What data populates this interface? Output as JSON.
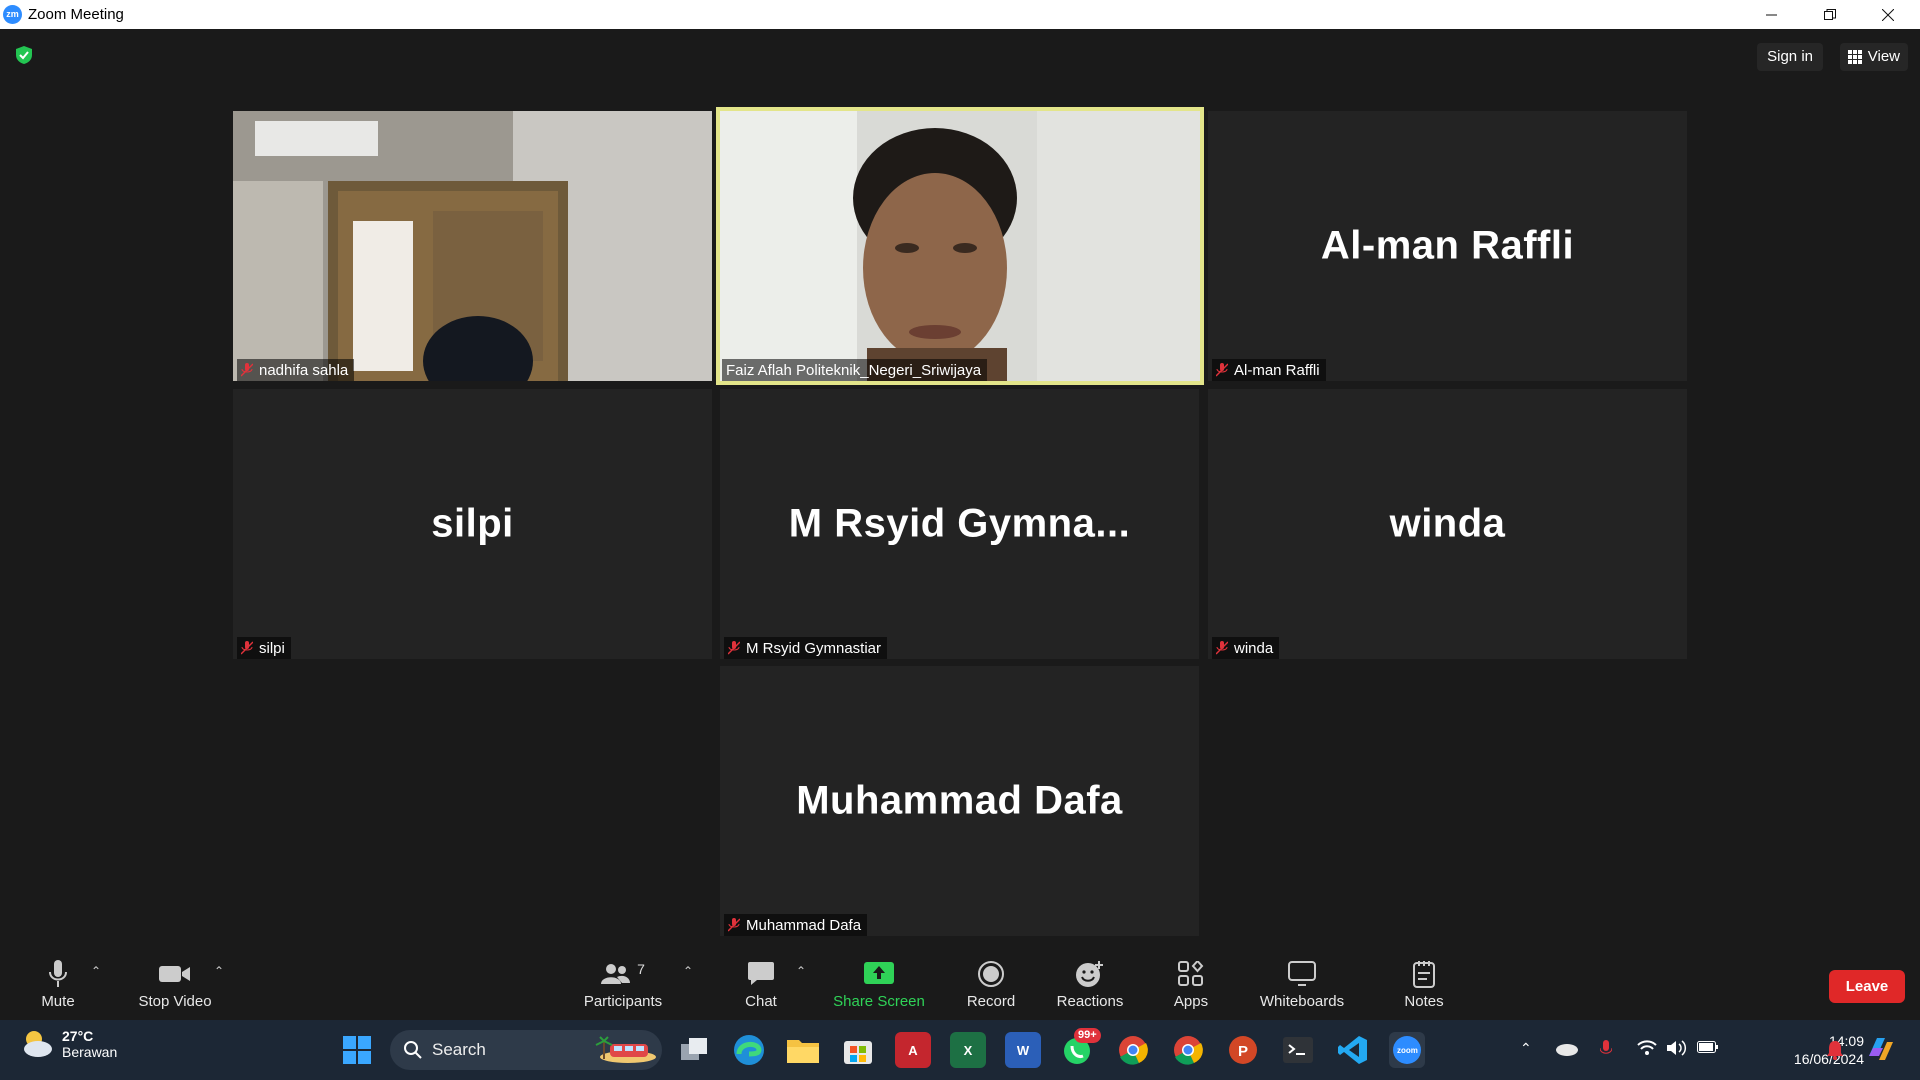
{
  "window": {
    "app_icon": "zoom-app-icon",
    "title": "Zoom Meeting"
  },
  "topbar": {
    "sign_in": "Sign in",
    "view": "View"
  },
  "tiles": [
    {
      "name": "nadhifa sahla",
      "big_name": "",
      "video": true
    },
    {
      "name": "Faiz Aflah Politeknik_Negeri_Sriwijaya",
      "big_name": "",
      "video": true,
      "active_speaker": true
    },
    {
      "name": "Al-man Raffli",
      "big_name": "Al-man Raffli",
      "video": false
    },
    {
      "name": "silpi",
      "big_name": "silpi",
      "video": false
    },
    {
      "name": "M Rsyid Gymnastiar",
      "big_name": "M Rsyid Gymna...",
      "video": false
    },
    {
      "name": "winda",
      "big_name": "winda",
      "video": false
    },
    {
      "name": "Muhammad Dafa",
      "big_name": "Muhammad Dafa",
      "video": false
    }
  ],
  "toolbar": {
    "mute": "Mute",
    "stop_video": "Stop Video",
    "participants": "Participants",
    "participants_count": "7",
    "chat": "Chat",
    "share_screen": "Share Screen",
    "record": "Record",
    "reactions": "Reactions",
    "apps": "Apps",
    "whiteboards": "Whiteboards",
    "notes": "Notes",
    "leave": "Leave"
  },
  "taskbar": {
    "weather_temp": "27°C",
    "weather_desc": "Berawan",
    "search": "Search",
    "whatsapp_badge": "99+",
    "time": "14:09",
    "date": "16/06/2024"
  },
  "colors": {
    "active_border": "#e3e58a",
    "leave": "#e02828",
    "share": "#2fd257",
    "zoom_blue": "#2d8cff"
  }
}
